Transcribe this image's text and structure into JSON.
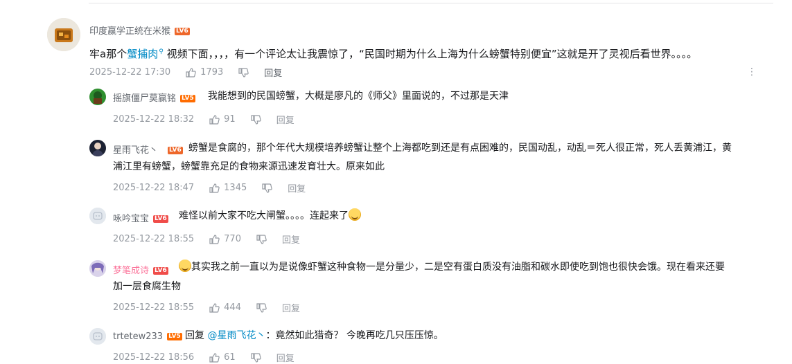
{
  "root_comment": {
    "username": "印度赢学正统在米猴",
    "level": "LV6",
    "text_prefix": "牢a那个",
    "link_text": "蟹捕肉",
    "text_suffix": " 视频下面，，，，有一个评论太让我震惊了，“民国时期为什么上海为什么螃蟹特别便宜”这就是开了灵视后看世界。。。。",
    "time": "2025-12-22 17:30",
    "likes": "1793",
    "reply_label": "回复",
    "more_label": "⋮"
  },
  "replies": [
    {
      "username": "摇旗僵尸莫赢铭",
      "level": "LV5",
      "text": "我能想到的民国螃蟹，大概是廖凡的《师父》里面说的，不过那是天津",
      "time": "2025-12-22 18:32",
      "likes": "91",
      "reply_label": "回复"
    },
    {
      "username": "星雨飞花丶",
      "level": "LV6",
      "text_line1": "螃蟹是食腐的，那个年代大规模培养螃蟹让整个上海都吃到还是有点困难的，民国动乱，动乱＝死人很正常，死人丢黄浦江，黄",
      "text_line2": "浦江里有螃蟹，螃蟹靠充足的食物来源迅速发育壮大。原来如此",
      "time": "2025-12-22 18:47",
      "likes": "1345",
      "reply_label": "回复"
    },
    {
      "username": "咏吟宝宝",
      "level": "LV6",
      "text": "难怪以前大家不吃大闸蟹。。。。连起来了",
      "time": "2025-12-22 18:55",
      "likes": "770",
      "reply_label": "回复"
    },
    {
      "username": "梦笔成诗",
      "level": "LV6",
      "text_line1": "其实我之前一直以为是说像虾蟹这种食物一是分量少，二是空有蛋白质没有油脂和碳水即使吃到饱也很快会饿。现在看来还要",
      "text_line2": "加一层食腐生物",
      "time": "2025-12-22 18:55",
      "likes": "444",
      "reply_label": "回复"
    },
    {
      "username": "trtetew233",
      "level": "LV5",
      "reply_prefix": "回复 ",
      "mention": "@星雨飞花丶",
      "text": "：竟然如此猎奇？ 今晚再吃几只压压惊。",
      "time": "2025-12-22 18:56",
      "likes": "61",
      "reply_label": "回复"
    }
  ],
  "colors": {
    "link": "#008ac5",
    "level_badge": "#ff6c00",
    "muted": "#9499a0",
    "vip_name": "#fb7299"
  }
}
